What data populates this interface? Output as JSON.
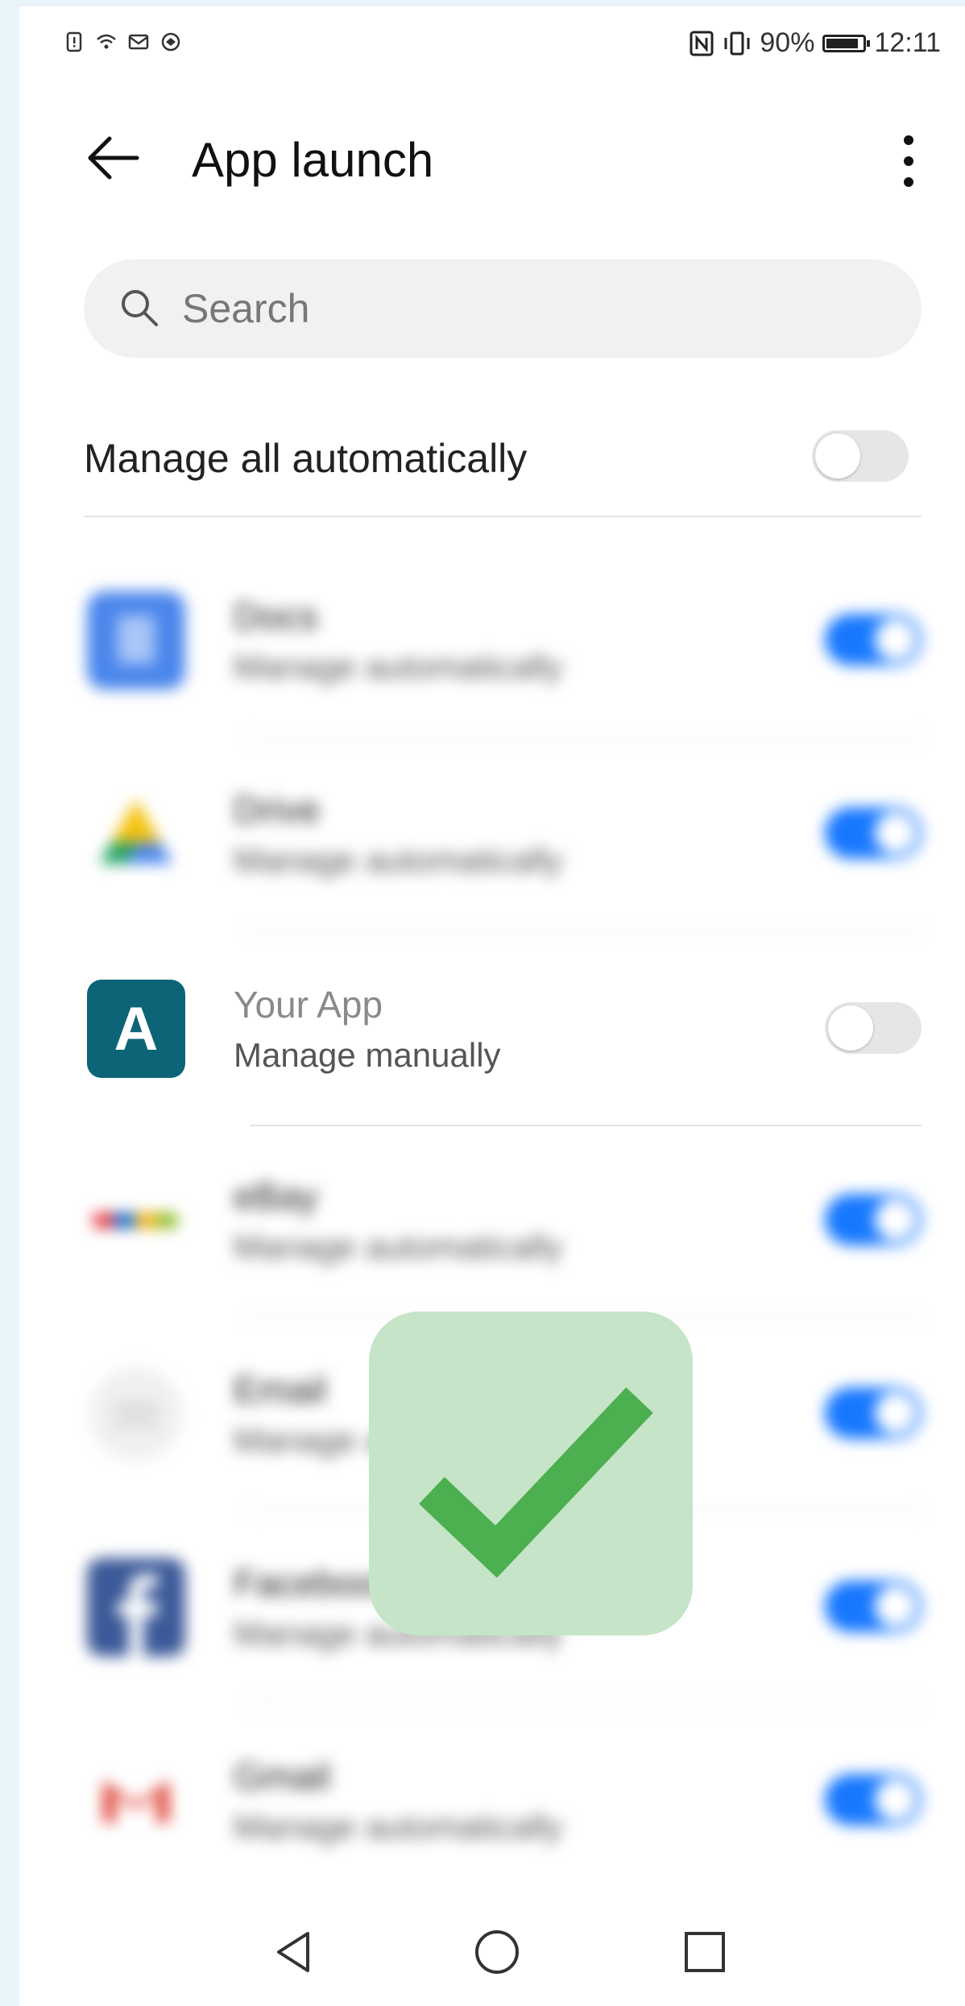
{
  "status_bar": {
    "icons": [
      "alert-icon",
      "wifi-icon",
      "mail-icon",
      "vpn-icon"
    ],
    "battery": "90%",
    "time": "12:11"
  },
  "header": {
    "title": "App launch"
  },
  "search": {
    "placeholder": "Search"
  },
  "manage_all": {
    "label": "Manage all automatically",
    "enabled": false
  },
  "apps": [
    {
      "name": "Docs",
      "subtitle": "Manage automatically",
      "icon": "docs-icon",
      "enabled": true,
      "blurred": true
    },
    {
      "name": "Drive",
      "subtitle": "Manage automatically",
      "icon": "drive-icon",
      "enabled": true,
      "blurred": true
    },
    {
      "name": "Your App",
      "subtitle": "Manage manually",
      "icon": "A",
      "enabled": false,
      "blurred": false
    },
    {
      "name": "eBay",
      "subtitle": "Manage automatically",
      "icon": "ebay-icon",
      "enabled": true,
      "blurred": true
    },
    {
      "name": "Email",
      "subtitle": "Manage automatically",
      "icon": "email-icon",
      "enabled": true,
      "blurred": true
    },
    {
      "name": "Facebook",
      "subtitle": "Manage automatically",
      "icon": "facebook-icon",
      "enabled": true,
      "blurred": true
    },
    {
      "name": "Gmail",
      "subtitle": "Manage automatically",
      "icon": "gmail-icon",
      "enabled": true,
      "blurred": true
    }
  ],
  "overlay": {
    "icon": "checkmark-icon",
    "color": "#4caf50",
    "background": "#c6e4c8"
  },
  "colors": {
    "toggle_on": "#1677ff",
    "your_app_icon": "#0d6477"
  },
  "nav": {
    "icons": [
      "back-triangle-icon",
      "home-circle-icon",
      "recents-square-icon"
    ]
  }
}
